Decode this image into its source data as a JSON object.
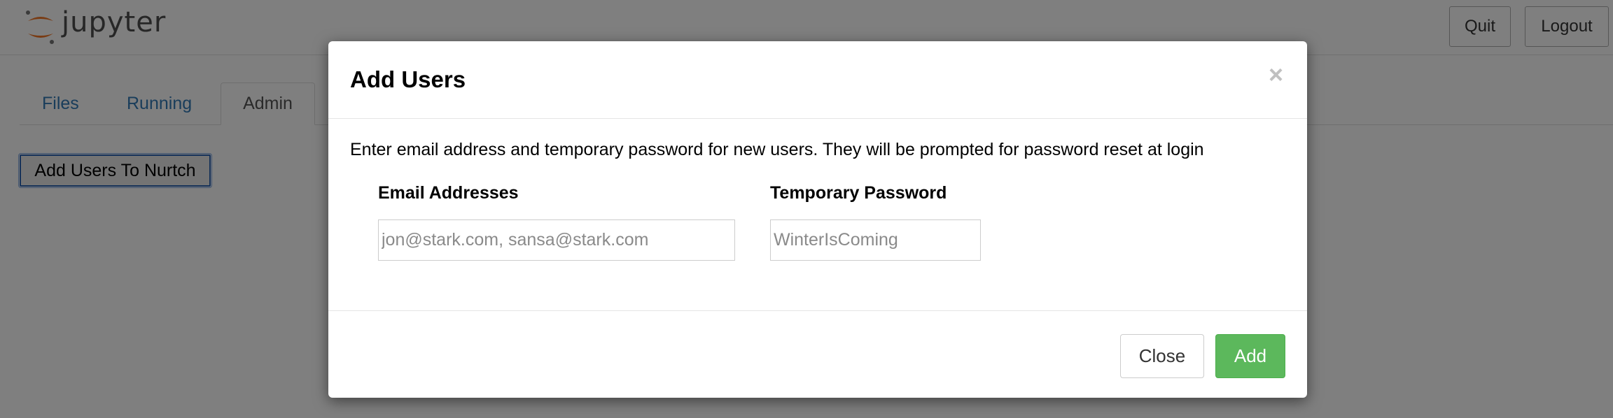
{
  "header": {
    "logo_text": "jupyter",
    "quit_label": "Quit",
    "logout_label": "Logout"
  },
  "tabs": [
    {
      "label": "Files"
    },
    {
      "label": "Running"
    },
    {
      "label": "Admin"
    }
  ],
  "admin": {
    "add_users_button": "Add Users To Nurtch"
  },
  "modal": {
    "title": "Add Users",
    "close_glyph": "×",
    "description": "Enter email address and temporary password for new users. They will be prompted for password reset at login",
    "email_label": "Email Addresses",
    "email_placeholder": "jon@stark.com, sansa@stark.com",
    "password_label": "Temporary Password",
    "password_placeholder": "WinterIsComing",
    "close_button": "Close",
    "add_button": "Add"
  },
  "colors": {
    "link": "#337ab7",
    "success": "#5cb85c",
    "jupyter_orange": "#f37726"
  }
}
